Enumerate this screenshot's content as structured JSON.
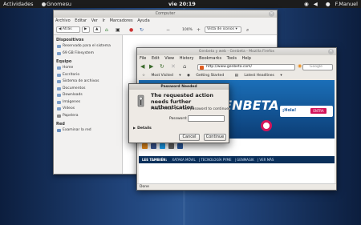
{
  "top_panel": {
    "activities": "Actividades",
    "app_name": "Gnomesu",
    "clock": "vie 20:19",
    "user": "F.Manuel"
  },
  "nautilus": {
    "title": "Computer",
    "menu": [
      "Archivo",
      "Editar",
      "Ver",
      "Ir",
      "Marcadores",
      "Ayuda"
    ],
    "back_label": "Atrás",
    "zoom": "100%",
    "view_mode": "Vista de iconos",
    "sidebar": [
      {
        "header": "Dispositivos",
        "items": [
          "Reservado para el sistema",
          "69 GB Filesystem"
        ]
      },
      {
        "header": "Equipo",
        "items": [
          "Home",
          "Escritorio",
          "Sistema de archivos",
          "Documentos",
          "Downloads",
          "Imágenes",
          "Vídeos",
          "Papelera"
        ]
      },
      {
        "header": "Red",
        "items": [
          "Examinar la red"
        ]
      }
    ]
  },
  "firefox": {
    "title": "Genbeta y web - Genbeta - Mozilla Firefox",
    "menu": [
      "File",
      "Edit",
      "View",
      "History",
      "Bookmarks",
      "Tools",
      "Help"
    ],
    "url": "http://www.genbeta.com/",
    "search_placeholder": "Google",
    "bookmarks": [
      "Most Visited",
      "Getting Started",
      "Latest Headlines"
    ],
    "status": "Done",
    "page": {
      "logo": "GENBETA",
      "hola": "¡Hola!",
      "entra": "ENTRA",
      "nav_lead": "LEE TAMBIÉN:",
      "nav_links": [
        "XATAKA MÓVIL",
        "TECNOLOGÍA PYME",
        "GENMAGIK",
        "VER MÁS"
      ]
    }
  },
  "dialog": {
    "title": "Password Needed",
    "heading": "The requested action needs further authentication",
    "subtext": "Please enter the root password to continue.",
    "password_label": "Password:",
    "password_value": "",
    "details_label": "Details",
    "cancel": "Cancel",
    "continue": "Continue"
  },
  "colors": {
    "desktop": "#21457c",
    "genbeta_blue": "#1b6fb8",
    "entra_pink": "#d4145a"
  }
}
